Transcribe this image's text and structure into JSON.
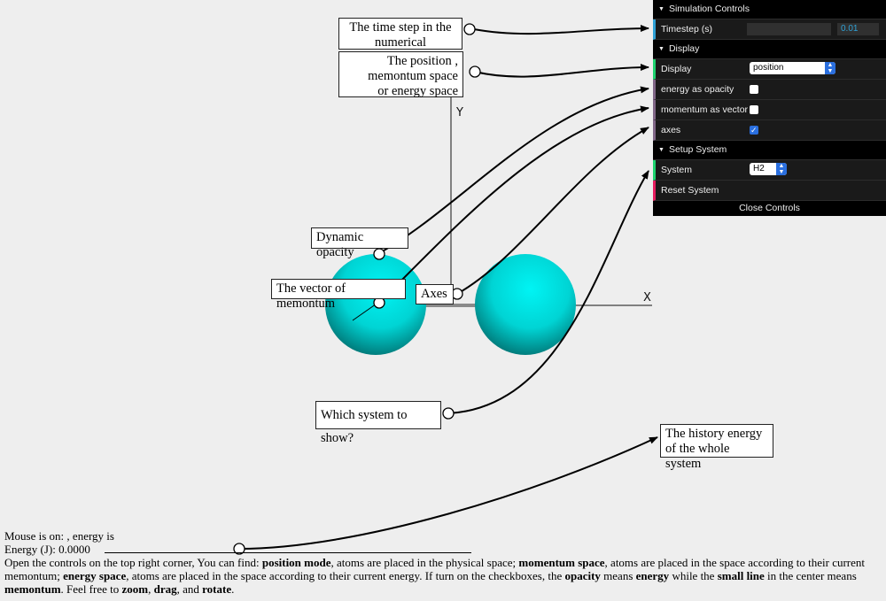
{
  "controls": {
    "simulation_title": "Simulation Controls",
    "timestep_label": "Timestep (s)",
    "timestep_value": "0.01",
    "display_title": "Display",
    "display_label": "Display",
    "display_value": "position",
    "energy_opacity_label": "energy as opacity",
    "energy_opacity_checked": false,
    "momentum_vector_label": "momentum as vector",
    "momentum_vector_checked": false,
    "axes_label": "axes",
    "axes_checked": true,
    "setup_title": "Setup System",
    "system_label": "System",
    "system_value": "H2",
    "reset_label": "Reset System",
    "close_label": "Close Controls"
  },
  "annotations": {
    "timestep": [
      "The time step in the",
      "numerical intergration"
    ],
    "display": [
      "The position ,",
      "memontum space",
      "or energy space"
    ],
    "opacity": "Dynamic opacity",
    "vector": "The vector of memontum",
    "axes": "Axes",
    "system": "Which system to show?",
    "history": [
      "The history energy",
      "of the whole system"
    ]
  },
  "scene": {
    "axis_y_label": "Y",
    "axis_x_label": "X",
    "atom_color": "#00c8c8"
  },
  "status": {
    "mouse_text": "Mouse is on: , energy is",
    "energy_text": "Energy (J): 0.0000",
    "desc": {
      "p1": "Open the controls on the top right corner, You can find: ",
      "b1": "position mode",
      "p2": ", atoms are placed in the physical space; ",
      "b2": "momentum space",
      "p3": ", atoms are placed in the space according to their current memontum; ",
      "b3": "energy space",
      "p4": ", atoms are placed in the space according to their current energy. If turn on the checkboxes, the ",
      "b4": "opacity",
      "p5": " means ",
      "b5": "energy",
      "p6": " while the ",
      "b6": "small line",
      "p7": " in the center means ",
      "b7": "memontum",
      "p8": ". Feel free to ",
      "b8": "zoom",
      "p9": ", ",
      "b9": "drag",
      "p10": ", and ",
      "b10": "rotate",
      "p11": "."
    }
  }
}
